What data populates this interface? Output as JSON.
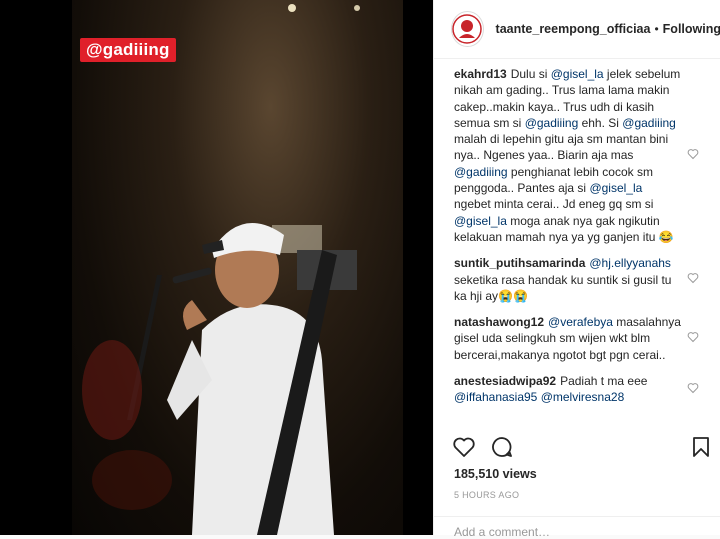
{
  "video": {
    "watermark": "@gadiiing"
  },
  "header": {
    "username": "taante_reempong_officiaa",
    "separator": "•",
    "follow_label": "Following"
  },
  "comments": [
    {
      "user": "ekahrd13",
      "parts": [
        {
          "t": "Dulu si "
        },
        {
          "m": "@gisel_la"
        },
        {
          "t": " jelek sebelum nikah am gading.. Trus lama lama makin cakep..makin kaya.. Trus udh di kasih semua sm si "
        },
        {
          "m": "@gadiiing"
        },
        {
          "t": " ehh. Si "
        },
        {
          "m": "@gadiiing"
        },
        {
          "t": " malah di lepehin gitu aja sm mantan bini nya.. Ngenes yaa.. Biarin aja mas "
        },
        {
          "m": "@gadiiing"
        },
        {
          "t": " penghianat lebih cocok sm penggoda.. Pantes aja si "
        },
        {
          "m": "@gisel_la"
        },
        {
          "t": " ngebet minta cerai.. Jd eneg gq sm si "
        },
        {
          "m": "@gisel_la"
        },
        {
          "t": " moga anak nya gak ngikutin kelakuan mamah nya ya yg ganjen itu 😂"
        }
      ]
    },
    {
      "user": "suntik_putihsamarinda",
      "parts": [
        {
          "m": "@hj.ellyyanahs"
        },
        {
          "t": " seketika rasa handak ku suntik si gusil tu ka hji ay😭😭"
        }
      ]
    },
    {
      "user": "natashawong12",
      "parts": [
        {
          "m": "@verafebya"
        },
        {
          "t": " masalahnya gisel uda selingkuh sm wijen wkt blm bercerai,makanya ngotot bgt pgn cerai.."
        }
      ]
    },
    {
      "user": "anestesiadwipa92",
      "parts": [
        {
          "t": "Padiah t ma eee "
        },
        {
          "m": "@iffahanasia95"
        },
        {
          "t": " "
        },
        {
          "m": "@melviresna28"
        }
      ]
    }
  ],
  "stats": {
    "views": "185,510 views",
    "time": "5 HOURS AGO"
  },
  "add_comment": {
    "placeholder": "Add a comment…"
  },
  "icons": {
    "heart": "heart-icon",
    "comment": "comment-icon",
    "bookmark": "bookmark-icon"
  }
}
